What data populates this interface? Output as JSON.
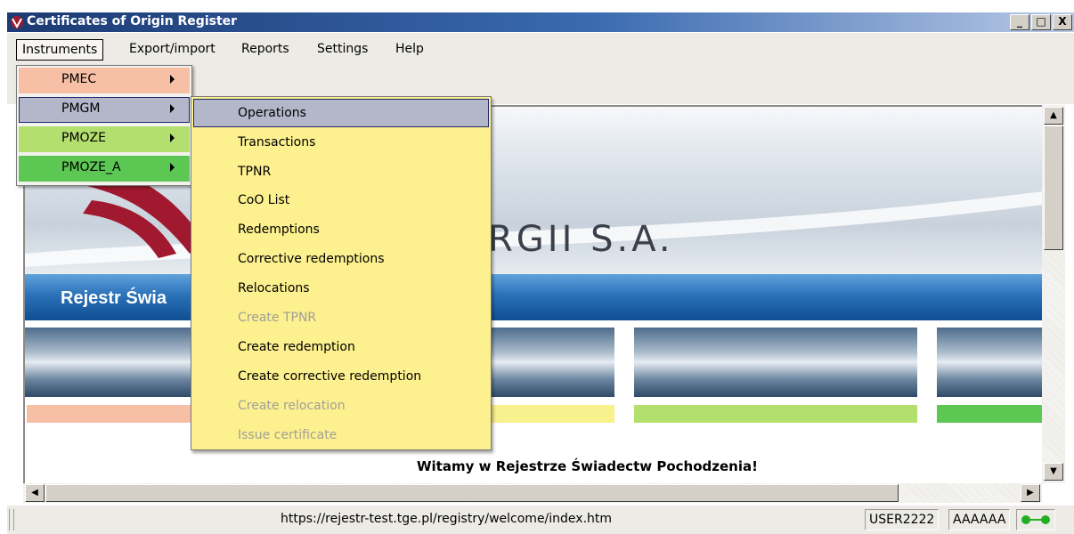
{
  "window": {
    "title": "Certificates of Origin Register",
    "minimize_glyph": "_",
    "maximize_glyph": "□",
    "close_glyph": "X"
  },
  "menubar": {
    "items": [
      "Instruments",
      "Export/import",
      "Reports",
      "Settings",
      "Help"
    ]
  },
  "instruments_menu": {
    "items": [
      {
        "label": "PMEC",
        "color": "#f7c0a6"
      },
      {
        "label": "PMGM",
        "color": "#b3b7c9"
      },
      {
        "label": "PMOZE",
        "color": "#b3df6e"
      },
      {
        "label": "PMOZE_A",
        "color": "#5cc753"
      }
    ]
  },
  "submenu": {
    "background": "#fdf08e",
    "items": [
      {
        "label": "Operations",
        "enabled": true
      },
      {
        "label": "Transactions",
        "enabled": true
      },
      {
        "label": "TPNR",
        "enabled": true
      },
      {
        "label": "CoO List",
        "enabled": true
      },
      {
        "label": "Redemptions",
        "enabled": true
      },
      {
        "label": "Corrective redemptions",
        "enabled": true
      },
      {
        "label": "Relocations",
        "enabled": true
      },
      {
        "label": "Create TPNR",
        "enabled": false
      },
      {
        "label": "Create redemption",
        "enabled": true
      },
      {
        "label": "Create corrective redemption",
        "enabled": true
      },
      {
        "label": "Create relocation",
        "enabled": false
      },
      {
        "label": "Issue certificate",
        "enabled": false
      }
    ]
  },
  "page": {
    "company_text": "RGII S.A.",
    "band_text": "Rejestr Świa",
    "welcome": "Witamy w Rejestrze Świadectw Pochodzenia!",
    "bar_colors": [
      "#f7c0a6",
      "#f9f08e",
      "#b3df6e",
      "#5cc753"
    ]
  },
  "statusbar": {
    "url": "https://rejestr-test.tge.pl/registry/welcome/index.htm",
    "user": "USER2222",
    "account": "AAAAAA",
    "connection_icon": "connected-icon"
  }
}
